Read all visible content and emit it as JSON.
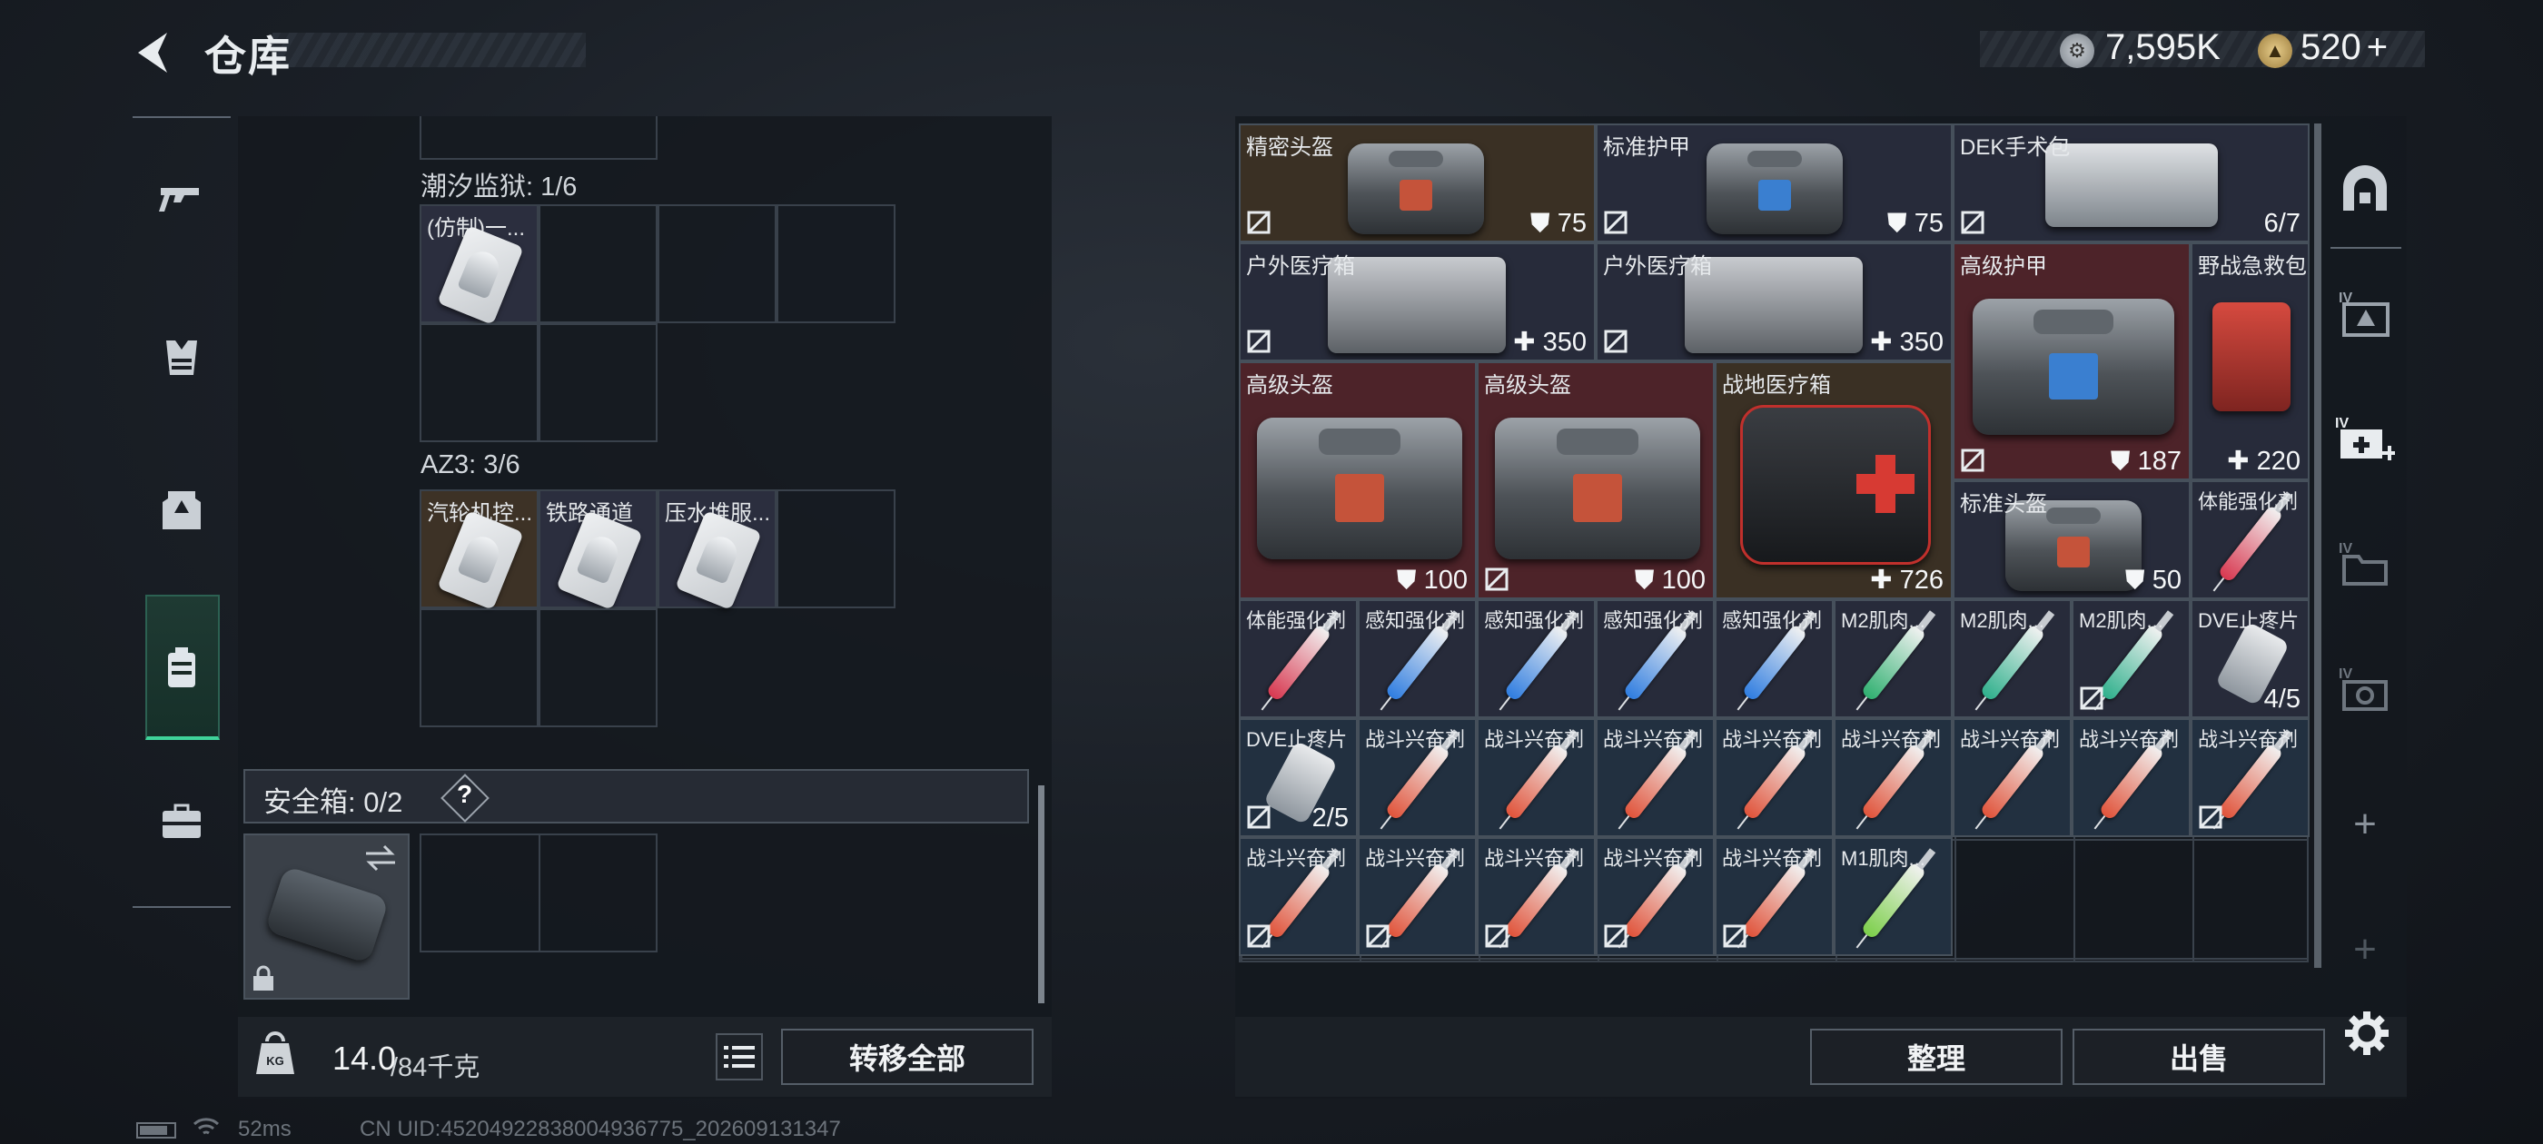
{
  "header": {
    "title": "仓库",
    "currency1_value": "7,595K",
    "currency2_value": "520",
    "currency2_add": "+"
  },
  "nav": [
    "weapon-tab",
    "vest-tab",
    "armor-tab",
    "backpack-tab",
    "case-tab"
  ],
  "left": {
    "section1_label": "潮汐监狱: 1/6",
    "section1_item": "(仿制)一...",
    "section2_label": "AZ3: 3/6",
    "section2_items": [
      "汽轮机控...",
      "铁路通道",
      "压水堆服..."
    ],
    "safe_label": "安全箱:  0/2",
    "safe_help": "?",
    "weight_current": "14.0",
    "weight_max": "/84千克",
    "weight_icon": "KG",
    "move_all": "转移全部"
  },
  "status": {
    "ping": "52ms",
    "uid": "CN UID:45204922838004936775_202609131347"
  },
  "stash": {
    "items": [
      {
        "name": "精密头盔",
        "value": "75",
        "prefix": "shield"
      },
      {
        "name": "标准护甲",
        "value": "75",
        "prefix": "shield"
      },
      {
        "name": "DEK手术包",
        "value": "6/7",
        "prefix": ""
      },
      {
        "name": "户外医疗箱",
        "value": "350",
        "prefix": "plus"
      },
      {
        "name": "户外医疗箱",
        "value": "350",
        "prefix": "plus"
      },
      {
        "name": "高级护甲",
        "value": "187",
        "prefix": "shield"
      },
      {
        "name": "野战急救包",
        "value": "220",
        "prefix": "plus"
      },
      {
        "name": "高级头盔",
        "value": "100",
        "prefix": "shield"
      },
      {
        "name": "高级头盔",
        "value": "100",
        "prefix": "shield"
      },
      {
        "name": "战地医疗箱",
        "value": "726",
        "prefix": "plus"
      },
      {
        "name": "标准头盔",
        "value": "50",
        "prefix": "shield"
      },
      {
        "name": "体能强化剂",
        "value": "",
        "prefix": ""
      },
      {
        "name": "体能强化剂",
        "value": "",
        "prefix": ""
      },
      {
        "name": "感知强化剂",
        "value": "",
        "prefix": ""
      },
      {
        "name": "感知强化剂",
        "value": "",
        "prefix": ""
      },
      {
        "name": "感知强化剂",
        "value": "",
        "prefix": ""
      },
      {
        "name": "感知强化剂",
        "value": "",
        "prefix": ""
      },
      {
        "name": "M2肌肉...",
        "value": "",
        "prefix": ""
      },
      {
        "name": "M2肌肉...",
        "value": "",
        "prefix": ""
      },
      {
        "name": "M2肌肉...",
        "value": "",
        "prefix": ""
      },
      {
        "name": "DVE止疼片",
        "value": "4/5",
        "prefix": ""
      },
      {
        "name": "DVE止疼片",
        "value": "2/5",
        "prefix": ""
      },
      {
        "name": "战斗兴奋剂",
        "value": "",
        "prefix": ""
      },
      {
        "name": "M1肌肉...",
        "value": "",
        "prefix": ""
      }
    ]
  },
  "actions": {
    "sort": "整理",
    "sell": "出售"
  },
  "side": {
    "add1": "+",
    "add2": "+"
  }
}
